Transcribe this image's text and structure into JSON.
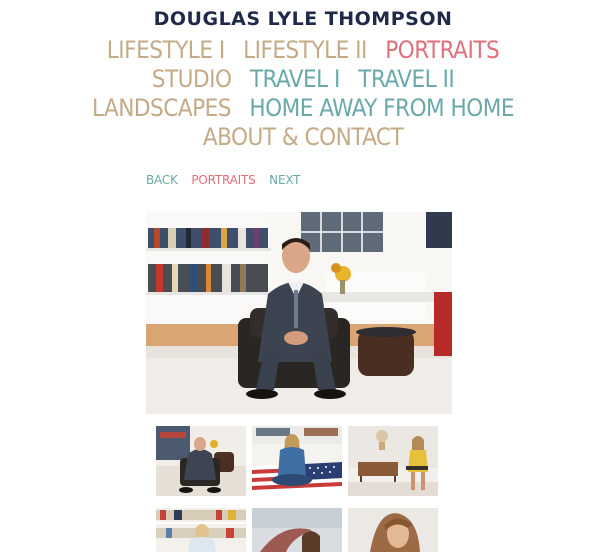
{
  "site": {
    "title": "DOUGLAS LYLE THOMPSON"
  },
  "nav": {
    "line1": [
      {
        "label": "LIFESTYLE I",
        "state": "tan"
      },
      {
        "label": "LIFESTYLE II",
        "state": "tan"
      },
      {
        "label": "PORTRAITS",
        "state": "pink"
      }
    ],
    "line2": [
      {
        "label": "STUDIO",
        "state": "tan"
      },
      {
        "label": "TRAVEL I",
        "state": "teal"
      },
      {
        "label": "TRAVEL II",
        "state": "teal"
      }
    ],
    "line3": [
      {
        "label": "LANDSCAPES",
        "state": "tan"
      },
      {
        "label": "HOME AWAY FROM HOME",
        "state": "teal"
      }
    ],
    "line4": [
      {
        "label": "ABOUT & CONTACT",
        "state": "tan"
      }
    ]
  },
  "subnav": {
    "back": "BACK",
    "current": "PORTRAITS",
    "next": "NEXT"
  },
  "colors": {
    "tan": "#c4aa86",
    "teal": "#6aa9a9",
    "pink": "#e0707c",
    "title": "#1f2a4a"
  },
  "gallery": {
    "main_image": "portrait-man-in-suit-in-chair",
    "thumbnails": [
      "man-in-suit-in-chair",
      "woman-on-flag-rug",
      "woman-in-yellow-dress-in-room",
      "woman-by-bookshelf",
      "woman-with-scarf-outdoors",
      "woman-with-long-hair"
    ]
  }
}
